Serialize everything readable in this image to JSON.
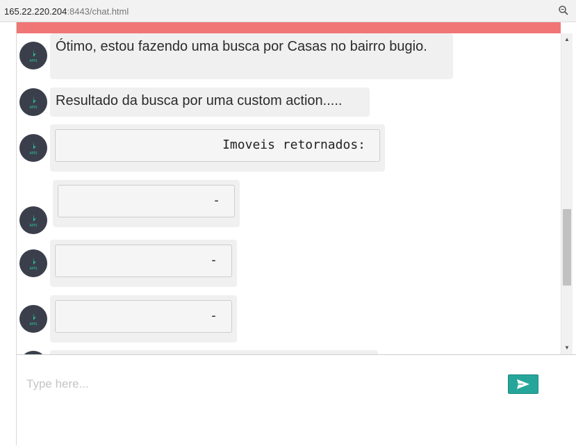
{
  "browser": {
    "url_host": "165.22.220.204",
    "url_rest": ":8443/chat.html",
    "zoom_icon": "magnifier-zoom-icon"
  },
  "chat": {
    "accent_color": "#f07575",
    "avatar_icon": "bot-avatar-icon",
    "messages": [
      {
        "text": "Ótimo, estou fazendo uma busca por Casas no bairro bugio."
      },
      {
        "text": "Resultado da busca por uma custom action....."
      },
      {
        "text": "Imoveis retornados:"
      },
      {
        "text": "-"
      },
      {
        "text": "-"
      },
      {
        "text": "-"
      }
    ]
  },
  "composer": {
    "placeholder": "Type here...",
    "send_icon": "send-icon",
    "send_color": "#26a69a"
  }
}
